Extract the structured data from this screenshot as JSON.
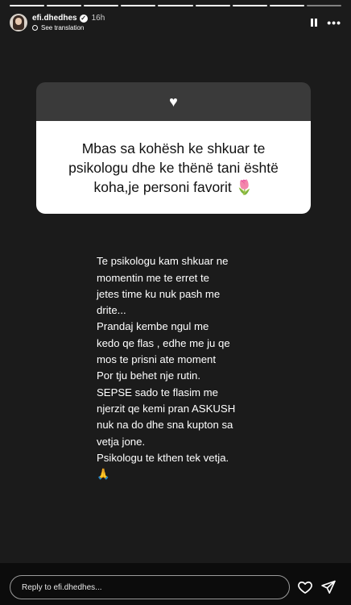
{
  "story": {
    "progress_segments": 9,
    "progress_done": 8
  },
  "header": {
    "username": "efi.dhedhes",
    "time": "16h",
    "see_translation": "See translation",
    "avatar_icon": "user-avatar",
    "verified_icon": "verified-badge-icon",
    "pause_icon": "pause-icon",
    "more_icon": "more-icon"
  },
  "question": {
    "icon": "heart-icon",
    "text": "Mbas sa kohësh ke shkuar te psikologu dhe ke thënë tani është koha,je personi favorit",
    "emoji": "🌷"
  },
  "answer": {
    "text": "Te psikologu kam shkuar ne\nmomentin me te erret te\njetes time ku nuk pash me\ndrite...\nPrandaj kembe ngul me\nkedo qe flas , edhe me ju qe\nmos te prisni ate moment\nPor tju behet nje rutin.\nSEPSE sado te flasim me\nnjerzit qe kemi pran ASKUSH\nnuk na do dhe sna kupton sa\nvetja jone.\nPsikologu te kthen tek vetja.",
    "emoji": "🙏"
  },
  "footer": {
    "reply_placeholder": "Reply to efi.dhedhes...",
    "like_icon": "heart-outline-icon",
    "send_icon": "send-icon"
  }
}
